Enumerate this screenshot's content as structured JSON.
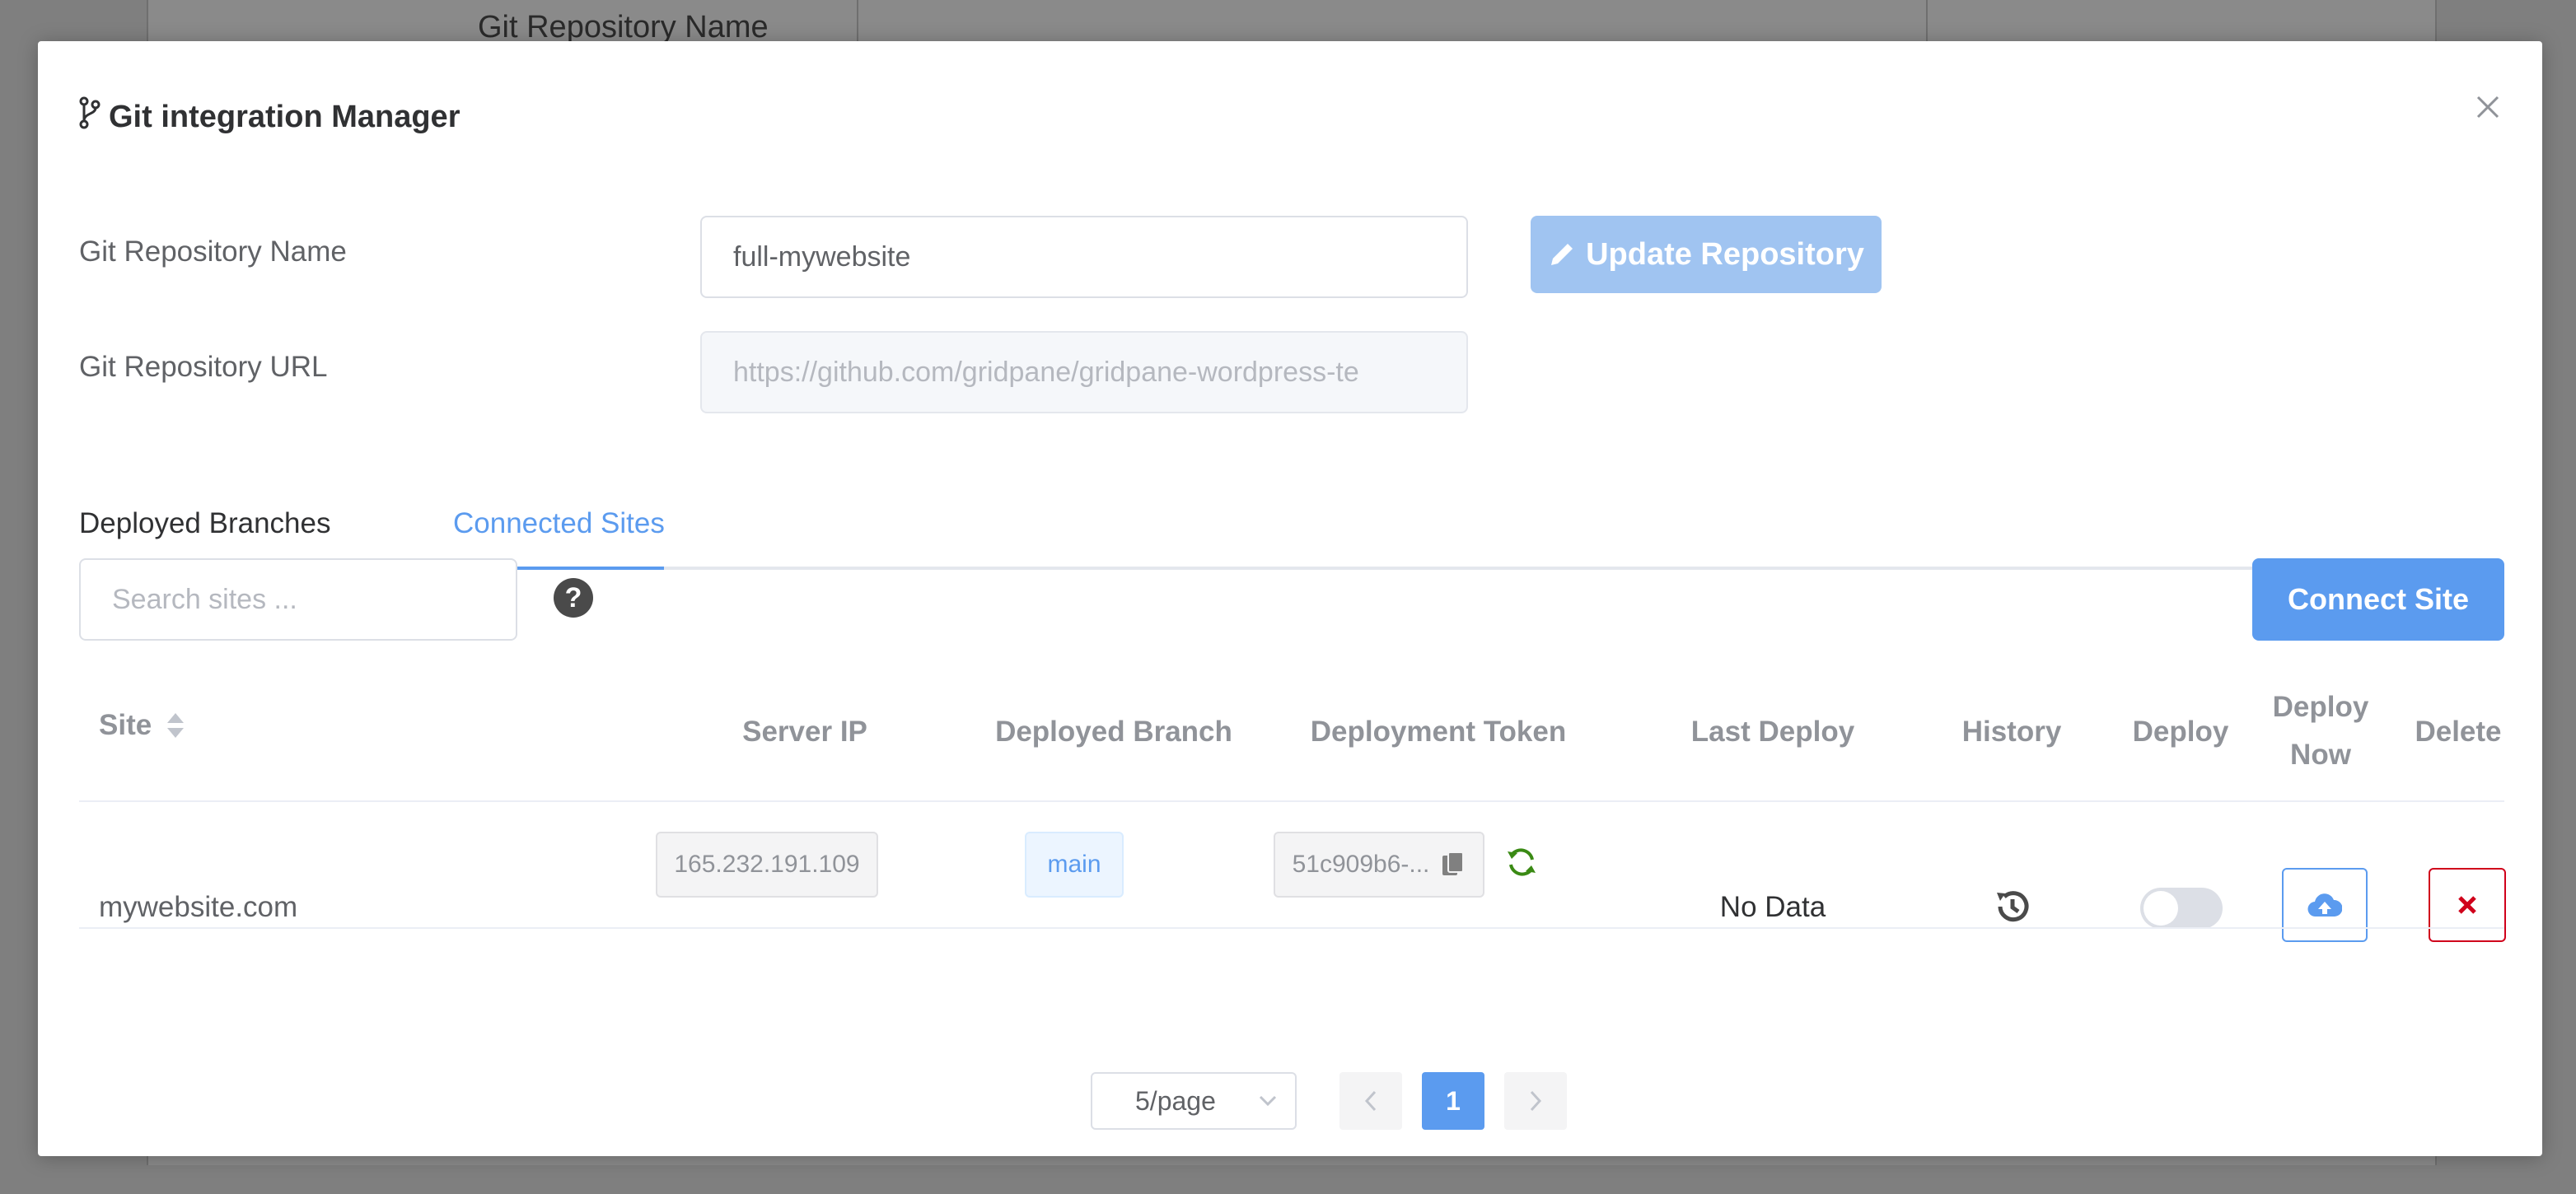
{
  "background": {
    "title": "Git Repository Name"
  },
  "modal": {
    "title": "Git integration Manager"
  },
  "form": {
    "repo_name_label": "Git Repository Name",
    "repo_name_value": "full-mywebsite",
    "repo_url_label": "Git Repository URL",
    "repo_url_value": "https://github.com/gridpane/gridpane-wordpress-te",
    "update_button": "Update Repository"
  },
  "tabs": [
    {
      "label": "Deployed Branches",
      "active": false
    },
    {
      "label": "Connected Sites",
      "active": true
    }
  ],
  "toolbar": {
    "search_placeholder": "Search sites ...",
    "help_icon": "?",
    "connect_button": "Connect Site"
  },
  "table": {
    "headers": {
      "site": "Site",
      "server_ip": "Server IP",
      "deployed_branch": "Deployed Branch",
      "deployment_token": "Deployment Token",
      "last_deploy": "Last Deploy",
      "history": "History",
      "deploy": "Deploy",
      "deploy_now_1": "Deploy",
      "deploy_now_2": "Now",
      "delete": "Delete"
    },
    "rows": [
      {
        "site": "mywebsite.com",
        "server_ip": "165.232.191.109",
        "branch": "main",
        "token": "51c909b6-...",
        "last_deploy": "No Data",
        "deploy_enabled": false
      }
    ]
  },
  "pagination": {
    "page_size": "5/page",
    "current_page": "1"
  },
  "colors": {
    "primary": "#5b9bef",
    "primary_light": "#a0c4f1",
    "danger": "#d0021b",
    "success": "#3a8a14"
  }
}
